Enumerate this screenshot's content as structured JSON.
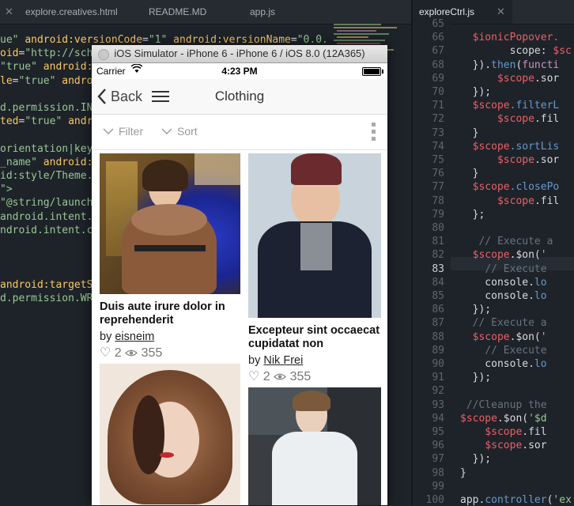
{
  "editor": {
    "tabs": [
      {
        "label": "explore.creatives.html",
        "active": false
      },
      {
        "label": "README.MD",
        "active": false
      },
      {
        "label": "app.js",
        "active": false
      },
      {
        "label": "exploreCtrl.js",
        "active": true
      }
    ],
    "left_code": [
      [
        {
          "t": "ue\" ",
          "c": "c-s"
        },
        {
          "t": "android:versionCode",
          "c": "c-a"
        },
        {
          "t": "=",
          "c": "c-w"
        },
        {
          "t": "\"1\" ",
          "c": "c-s"
        },
        {
          "t": "android:versionName",
          "c": "c-a"
        },
        {
          "t": "=",
          "c": "c-w"
        },
        {
          "t": "\"0.0.",
          "c": "c-s"
        }
      ],
      [
        {
          "t": "oid",
          "c": "c-a"
        },
        {
          "t": "=",
          "c": "c-w"
        },
        {
          "t": "\"http://sch",
          "c": "c-s"
        }
      ],
      [
        {
          "t": "\"true\" ",
          "c": "c-s"
        },
        {
          "t": "android:",
          "c": "c-a"
        }
      ],
      [
        {
          "t": "le",
          "c": "c-a"
        },
        {
          "t": "=",
          "c": "c-w"
        },
        {
          "t": "\"true\" ",
          "c": "c-s"
        },
        {
          "t": "andro",
          "c": "c-a"
        }
      ],
      [
        {
          "t": "",
          "c": "c-w"
        }
      ],
      [
        {
          "t": "d.permission.IN",
          "c": "c-s"
        }
      ],
      [
        {
          "t": "ted",
          "c": "c-a"
        },
        {
          "t": "=",
          "c": "c-w"
        },
        {
          "t": "\"true\" ",
          "c": "c-s"
        },
        {
          "t": "andr",
          "c": "c-a"
        }
      ],
      [
        {
          "t": "",
          "c": "c-w"
        }
      ],
      [
        {
          "t": "orientation|key",
          "c": "c-s"
        }
      ],
      [
        {
          "t": "_name\" ",
          "c": "c-s"
        },
        {
          "t": "android:",
          "c": "c-a"
        }
      ],
      [
        {
          "t": "id:style/Theme.",
          "c": "c-s"
        }
      ],
      [
        {
          "t": "\">",
          "c": "c-s"
        }
      ],
      [
        {
          "t": "\"@string/launch",
          "c": "c-s"
        }
      ],
      [
        {
          "t": "android.intent.act",
          "c": "c-s"
        }
      ],
      [
        {
          "t": "ndroid.intent.c",
          "c": "c-s"
        }
      ],
      [
        {
          "t": "",
          "c": "c-w"
        }
      ],
      [
        {
          "t": "",
          "c": "c-w"
        }
      ],
      [
        {
          "t": "",
          "c": "c-w"
        }
      ],
      [
        {
          "t": "android:targetS",
          "c": "c-a"
        }
      ],
      [
        {
          "t": "d.permission.WR",
          "c": "c-s"
        }
      ]
    ],
    "right_gutter": [
      "65",
      "66",
      "67",
      "68",
      "69",
      "70",
      "71",
      "72",
      "73",
      "74",
      "75",
      "76",
      "77",
      "78",
      "79",
      "80",
      "81",
      "82",
      "83",
      "84",
      "85",
      "86",
      "87",
      "88",
      "89",
      "90",
      "91",
      "92",
      "93",
      "94",
      "95",
      "96",
      "97",
      "98",
      "99",
      "100"
    ],
    "current_line": "83",
    "right_code": [
      [
        {
          "t": "  ",
          "c": "c-w"
        }
      ],
      [
        {
          "t": "  ",
          "c": "c-w"
        },
        {
          "t": "$ionicPopover.",
          "c": "c-r"
        }
      ],
      [
        {
          "t": "        scope: ",
          "c": "c-w"
        },
        {
          "t": "$sc",
          "c": "c-r"
        }
      ],
      [
        {
          "t": "  }).",
          "c": "c-w"
        },
        {
          "t": "then",
          "c": "c-b"
        },
        {
          "t": "(",
          "c": "c-w"
        },
        {
          "t": "functi",
          "c": "c-k"
        }
      ],
      [
        {
          "t": "      ",
          "c": "c-w"
        },
        {
          "t": "$scope",
          "c": "c-r"
        },
        {
          "t": ".sor",
          "c": "c-w"
        }
      ],
      [
        {
          "t": "  });",
          "c": "c-w"
        }
      ],
      [
        {
          "t": "  ",
          "c": "c-w"
        },
        {
          "t": "$scope",
          "c": "c-r"
        },
        {
          "t": ".filterL",
          "c": "c-b"
        }
      ],
      [
        {
          "t": "      ",
          "c": "c-w"
        },
        {
          "t": "$scope",
          "c": "c-r"
        },
        {
          "t": ".fil",
          "c": "c-w"
        }
      ],
      [
        {
          "t": "  }",
          "c": "c-w"
        }
      ],
      [
        {
          "t": "  ",
          "c": "c-w"
        },
        {
          "t": "$scope",
          "c": "c-r"
        },
        {
          "t": ".sortLis",
          "c": "c-b"
        }
      ],
      [
        {
          "t": "      ",
          "c": "c-w"
        },
        {
          "t": "$scope",
          "c": "c-r"
        },
        {
          "t": ".sor",
          "c": "c-w"
        }
      ],
      [
        {
          "t": "  }",
          "c": "c-w"
        }
      ],
      [
        {
          "t": "  ",
          "c": "c-w"
        },
        {
          "t": "$scope",
          "c": "c-r"
        },
        {
          "t": ".closePo",
          "c": "c-b"
        }
      ],
      [
        {
          "t": "      ",
          "c": "c-w"
        },
        {
          "t": "$scope",
          "c": "c-r"
        },
        {
          "t": ".fil",
          "c": "c-w"
        }
      ],
      [
        {
          "t": "  };",
          "c": "c-w"
        }
      ],
      [
        {
          "t": "",
          "c": "c-w"
        }
      ],
      [
        {
          "t": "   ",
          "c": "c-w"
        },
        {
          "t": "// Execute a",
          "c": "c-cm"
        }
      ],
      [
        {
          "t": "  ",
          "c": "c-w"
        },
        {
          "t": "$scope",
          "c": "c-r"
        },
        {
          "t": ".$on(",
          "c": "c-w"
        },
        {
          "t": "'",
          "c": "c-s"
        }
      ],
      [
        {
          "t": "    ",
          "c": "c-w"
        },
        {
          "t": "// Execute",
          "c": "c-cm"
        }
      ],
      [
        {
          "t": "    console.",
          "c": "c-w"
        },
        {
          "t": "lo",
          "c": "c-b"
        }
      ],
      [
        {
          "t": "    console.",
          "c": "c-w"
        },
        {
          "t": "lo",
          "c": "c-b"
        }
      ],
      [
        {
          "t": "  });",
          "c": "c-w"
        }
      ],
      [
        {
          "t": "  ",
          "c": "c-w"
        },
        {
          "t": "// Execute a",
          "c": "c-cm"
        }
      ],
      [
        {
          "t": "  ",
          "c": "c-w"
        },
        {
          "t": "$scope",
          "c": "c-r"
        },
        {
          "t": ".$on(",
          "c": "c-w"
        },
        {
          "t": "'",
          "c": "c-s"
        }
      ],
      [
        {
          "t": "    ",
          "c": "c-w"
        },
        {
          "t": "// Execute",
          "c": "c-cm"
        }
      ],
      [
        {
          "t": "    console.",
          "c": "c-w"
        },
        {
          "t": "lo",
          "c": "c-b"
        }
      ],
      [
        {
          "t": "  });",
          "c": "c-w"
        }
      ],
      [
        {
          "t": "",
          "c": "c-w"
        }
      ],
      [
        {
          "t": " ",
          "c": "c-w"
        },
        {
          "t": "//Cleanup the",
          "c": "c-cm"
        }
      ],
      [
        {
          "t": "",
          "c": "c-w"
        },
        {
          "t": "$scope",
          "c": "c-r"
        },
        {
          "t": ".$on(",
          "c": "c-w"
        },
        {
          "t": "'$d",
          "c": "c-s"
        }
      ],
      [
        {
          "t": "    ",
          "c": "c-w"
        },
        {
          "t": "$scope",
          "c": "c-r"
        },
        {
          "t": ".fil",
          "c": "c-w"
        }
      ],
      [
        {
          "t": "    ",
          "c": "c-w"
        },
        {
          "t": "$scope",
          "c": "c-r"
        },
        {
          "t": ".sor",
          "c": "c-w"
        }
      ],
      [
        {
          "t": "  });",
          "c": "c-w"
        }
      ],
      [
        {
          "t": "}",
          "c": "c-w"
        }
      ],
      [
        {
          "t": "",
          "c": "c-w"
        }
      ],
      [
        {
          "t": "app.",
          "c": "c-w"
        },
        {
          "t": "controller",
          "c": "c-b"
        },
        {
          "t": "(",
          "c": "c-w"
        },
        {
          "t": "'ex",
          "c": "c-s"
        }
      ]
    ]
  },
  "simulator": {
    "title": "iOS Simulator - iPhone 6 - iPhone 6 / iOS 8.0 (12A365)",
    "status": {
      "carrier": "Carrier",
      "time": "4:23 PM"
    },
    "nav": {
      "back_label": "Back",
      "title": "Clothing"
    },
    "toolbar": {
      "filter_label": "Filter",
      "sort_label": "Sort"
    },
    "cards": [
      {
        "title": "Duis aute irure dolor in reprehenderit",
        "by": "by",
        "author": "eisneim",
        "likes": "2",
        "views": "355"
      },
      {
        "title": "Excepteur sint occaecat cupidatat non",
        "by": "by",
        "author": "Nik Frei",
        "likes": "2",
        "views": "355"
      }
    ]
  }
}
